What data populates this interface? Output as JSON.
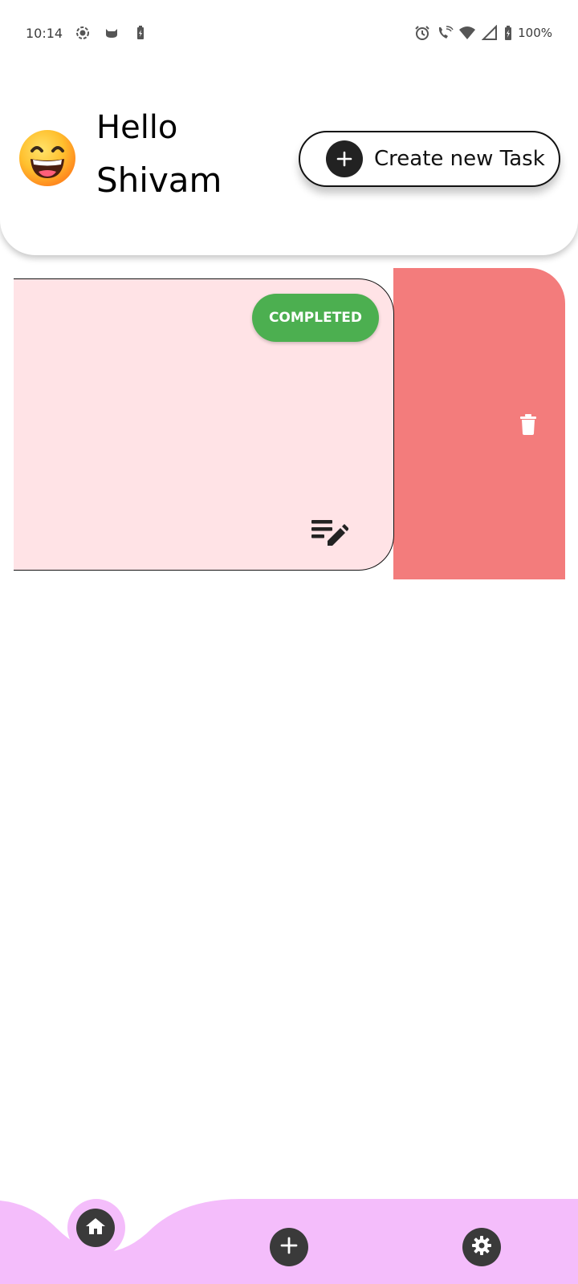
{
  "status_bar": {
    "time": "10:14",
    "battery": "100%",
    "icons_left": [
      "record-icon",
      "cat-icon",
      "battery-saver-icon"
    ],
    "icons_right": [
      "alarm-icon",
      "wifi-call-icon",
      "wifi-icon",
      "signal-icon",
      "battery-icon"
    ]
  },
  "header": {
    "greeting_line1": "Hello",
    "greeting_line2": "Shivam",
    "avatar": "grinning-face-emoji",
    "create_button_label": "Create new Task"
  },
  "tasks": [
    {
      "status": "COMPLETED",
      "status_color": "#4caf50",
      "card_color": "#ffe3e6",
      "delete_action_color": "#f37c7c"
    }
  ],
  "bottom_nav": {
    "active": "home",
    "bar_color": "#f4bdfb",
    "items": [
      "home-icon",
      "add-icon",
      "settings-icon"
    ]
  }
}
